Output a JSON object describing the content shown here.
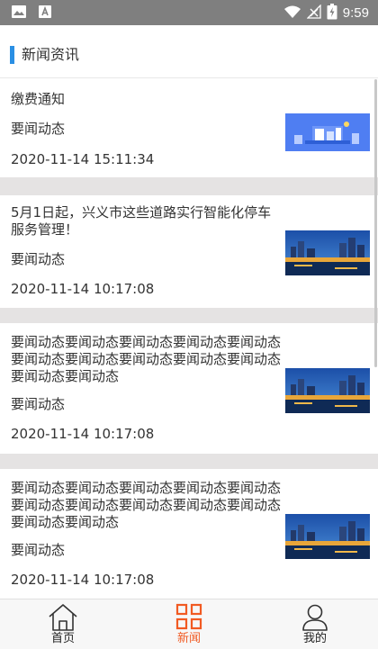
{
  "status_bar": {
    "time": "9:59",
    "icons": [
      "image-icon",
      "a-icon",
      "wifi-icon",
      "signal-icon",
      "battery-icon"
    ]
  },
  "header": {
    "title": "新闻资讯",
    "accent_color": "#2a8fe4"
  },
  "news": [
    {
      "title": "缴费通知",
      "category": "要闻动态",
      "date": "2020-11-14 15:11:34",
      "thumb": "blue-illustration"
    },
    {
      "title": "5月1日起，兴义市这些道路实行智能化停车服务管理！",
      "category": "要闻动态",
      "date": "2020-11-14 10:17:08",
      "thumb": "city-night"
    },
    {
      "title": "要闻动态要闻动态要闻动态要闻动态要闻动态要闻动态要闻动态要闻动态要闻动态要闻动态要闻动态要闻动态",
      "category": "要闻动态",
      "date": "2020-11-14 10:17:08",
      "thumb": "city-night"
    },
    {
      "title": "要闻动态要闻动态要闻动态要闻动态要闻动态要闻动态要闻动态要闻动态要闻动态要闻动态要闻动态要闻动态",
      "category": "要闻动态",
      "date": "2020-11-14 10:17:08",
      "thumb": "city-night"
    }
  ],
  "bottom_nav": {
    "items": [
      {
        "label": "首页",
        "icon": "home-icon"
      },
      {
        "label": "新闻",
        "icon": "news-grid-icon",
        "active": true
      },
      {
        "label": "我的",
        "icon": "user-icon"
      }
    ],
    "active_color": "#f15a22"
  }
}
